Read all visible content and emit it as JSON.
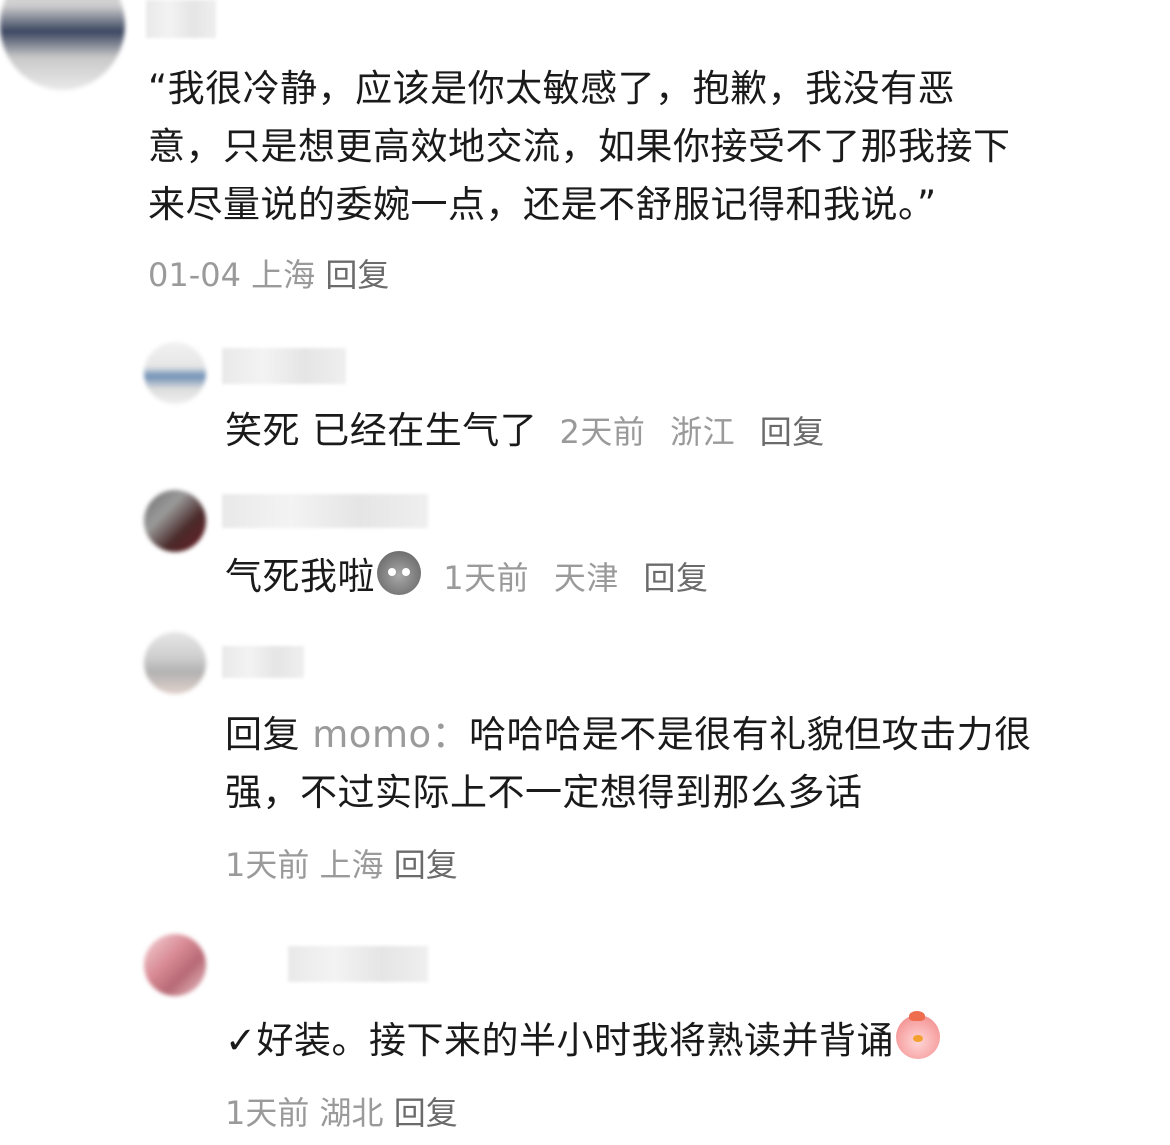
{
  "comments": [
    {
      "lines": [
        "“我很冷静，应该是你太敏感了，抱歉，我没有恶",
        "意，只是想更高效地交流，如果你接受不了那我接下",
        "来尽量说的委婉一点，还是不舒服记得和我说。”"
      ],
      "date": "01-04",
      "location": "上海",
      "reply": "回复"
    },
    {
      "text": "笑死 已经在生气了",
      "time": "2天前",
      "location": "浙江",
      "reply": "回复"
    },
    {
      "text": "气死我啦",
      "emoji": "angry-face-emoji",
      "time": "1天前",
      "location": "天津",
      "reply": "回复"
    },
    {
      "reply_label": "回复",
      "mention": "momo：",
      "line1": "哈哈哈是不是很有礼貌但攻击力很",
      "line2": "强，不过实际上不一定想得到那么多话",
      "time": "1天前",
      "location": "上海",
      "reply": "回复"
    },
    {
      "text": "✓好装。接下来的半小时我将熟读并背诵",
      "emoji": "chick-emoji",
      "time": "1天前",
      "location": "湖北",
      "reply": "回复"
    }
  ]
}
